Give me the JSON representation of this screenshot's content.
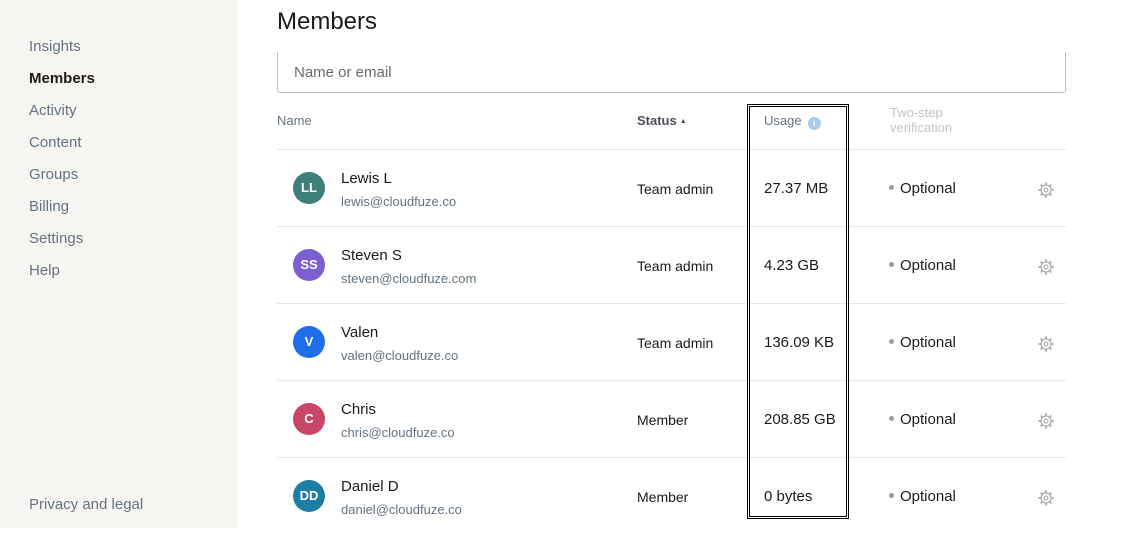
{
  "sidebar": {
    "items": [
      {
        "label": "Insights",
        "active": false
      },
      {
        "label": "Members",
        "active": true
      },
      {
        "label": "Activity",
        "active": false
      },
      {
        "label": "Content",
        "active": false
      },
      {
        "label": "Groups",
        "active": false
      },
      {
        "label": "Billing",
        "active": false
      },
      {
        "label": "Settings",
        "active": false
      },
      {
        "label": "Help",
        "active": false
      }
    ],
    "footer": "Privacy and legal"
  },
  "main": {
    "title": "Members",
    "search": {
      "placeholder": "Name or email",
      "value": ""
    },
    "columns": {
      "name": "Name",
      "status": "Status",
      "usage": "Usage",
      "two_step_line1": "Two-step",
      "two_step_line2": "verification"
    },
    "members": [
      {
        "initials": "LL",
        "avatar_color": "#3e7f7a",
        "name": "Lewis L",
        "email": "lewis@cloudfuze.co",
        "status": "Team admin",
        "usage": "27.37 MB",
        "two_step": "Optional"
      },
      {
        "initials": "SS",
        "avatar_color": "#7c5fd0",
        "name": "Steven S",
        "email": "steven@cloudfuze.com",
        "status": "Team admin",
        "usage": "4.23 GB",
        "two_step": "Optional"
      },
      {
        "initials": "V",
        "avatar_color": "#1f6ee8",
        "name": "Valen",
        "email": "valen@cloudfuze.co",
        "status": "Team admin",
        "usage": "136.09 KB",
        "two_step": "Optional"
      },
      {
        "initials": "C",
        "avatar_color": "#c84766",
        "name": "Chris",
        "email": "chris@cloudfuze.co",
        "status": "Member",
        "usage": "208.85 GB",
        "two_step": "Optional"
      },
      {
        "initials": "DD",
        "avatar_color": "#1c7fa3",
        "name": "Daniel D",
        "email": "daniel@cloudfuze.co",
        "status": "Member",
        "usage": "0 bytes",
        "two_step": "Optional"
      }
    ]
  },
  "icons": {
    "sort": "sort-ascending-icon",
    "info": "info-icon",
    "gear": "gear-icon"
  }
}
